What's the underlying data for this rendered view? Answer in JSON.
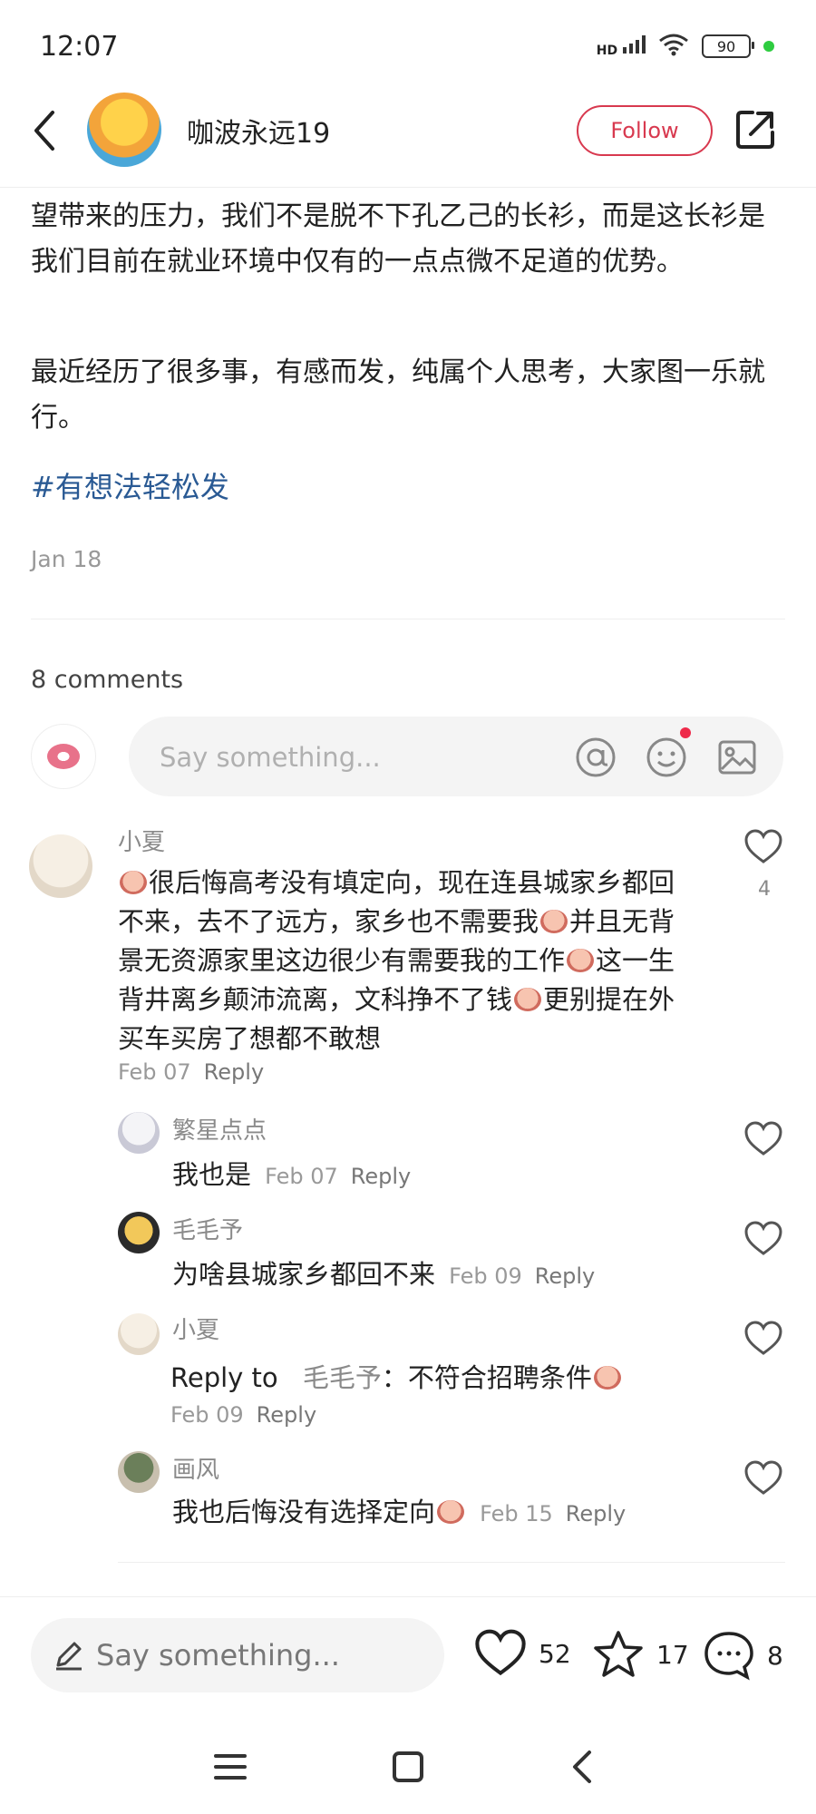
{
  "status_bar": {
    "time": "12:07",
    "signal_label": "HD",
    "battery": "90"
  },
  "header": {
    "author_name": "咖波永远19",
    "follow_label": "Follow"
  },
  "post": {
    "paragraphs": [
      "望带来的压力，我们不是脱不下孔乙己的长衫，而是这长衫是我们目前在就业环境中仅有的一点点微不足道的优势。",
      "最近经历了很多事，有感而发，纯属个人思考，大家图一乐就行。"
    ],
    "hashtag": "#有想法轻松发",
    "date": "Jan 18"
  },
  "comments_section": {
    "count_label": "8 comments",
    "input_placeholder": "Say something..."
  },
  "comments": [
    {
      "user": "小夏",
      "text_parts": [
        "很后悔高考没有填定向，现在连县城家乡都回不来，去不了远方，家乡也不需要我",
        "并且无背景无资源家里这边很少有需要我的工作",
        "这一生背井离乡颠沛流离，文科挣不了钱",
        "更别提在外买车买房了想都不敢想"
      ],
      "date": "Feb 07",
      "reply_label": "Reply",
      "likes": "4",
      "replies": [
        {
          "user": "繁星点点",
          "text": "我也是",
          "date": "Feb 07",
          "reply_label": "Reply"
        },
        {
          "user": "毛毛予",
          "text": "为啥县城家乡都回不来",
          "date": "Feb 09",
          "reply_label": "Reply"
        },
        {
          "user": "小夏",
          "reply_prefix": "Reply to",
          "mention": "毛毛予",
          "text": "：不符合招聘条件",
          "date": "Feb 09",
          "reply_label": "Reply"
        },
        {
          "user": "画风",
          "text": "我也后悔没有选择定向",
          "date": "Feb 15",
          "reply_label": "Reply"
        }
      ]
    }
  ],
  "bottom_bar": {
    "placeholder": "Say something...",
    "likes": "52",
    "favorites": "17",
    "comments": "8"
  },
  "colors": {
    "accent": "#d8394f",
    "hashtag": "#2a5a94",
    "muted": "#999999"
  }
}
